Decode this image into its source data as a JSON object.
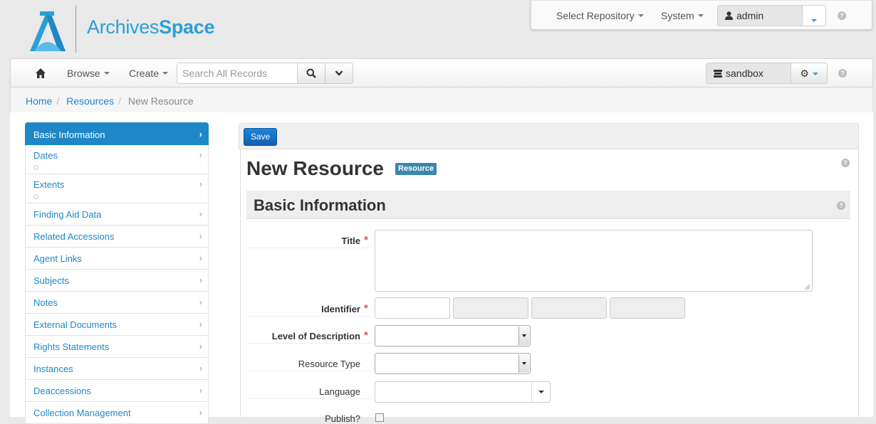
{
  "brand": {
    "name_part1": "Archives",
    "name_part2": "Space",
    "color": "#2a9fd6"
  },
  "topnav": {
    "select_repository": "Select Repository",
    "system": "System",
    "user": "admin"
  },
  "toolbar": {
    "browse": "Browse",
    "create": "Create",
    "search_placeholder": "Search All Records",
    "repository": "sandbox"
  },
  "breadcrumb": [
    "Home",
    "Resources",
    "New Resource"
  ],
  "sidebar": {
    "items": [
      {
        "label": "Basic Information"
      },
      {
        "label": "Dates"
      },
      {
        "label": "Extents"
      },
      {
        "label": "Finding Aid Data"
      },
      {
        "label": "Related Accessions"
      },
      {
        "label": "Agent Links"
      },
      {
        "label": "Subjects"
      },
      {
        "label": "Notes"
      },
      {
        "label": "External Documents"
      },
      {
        "label": "Rights Statements"
      },
      {
        "label": "Instances"
      },
      {
        "label": "Deaccessions"
      },
      {
        "label": "Collection Management"
      }
    ]
  },
  "form": {
    "save_label": "Save",
    "title": "New Resource",
    "badge": "Resource",
    "section_title": "Basic Information",
    "fields": {
      "title": "Title",
      "identifier": "Identifier",
      "level_of_description": "Level of Description",
      "resource_type": "Resource Type",
      "language": "Language",
      "publish": "Publish?"
    }
  },
  "colors": {
    "accent": "#1e87c8",
    "required": "#d9534f",
    "badge": "#3a87ad"
  }
}
